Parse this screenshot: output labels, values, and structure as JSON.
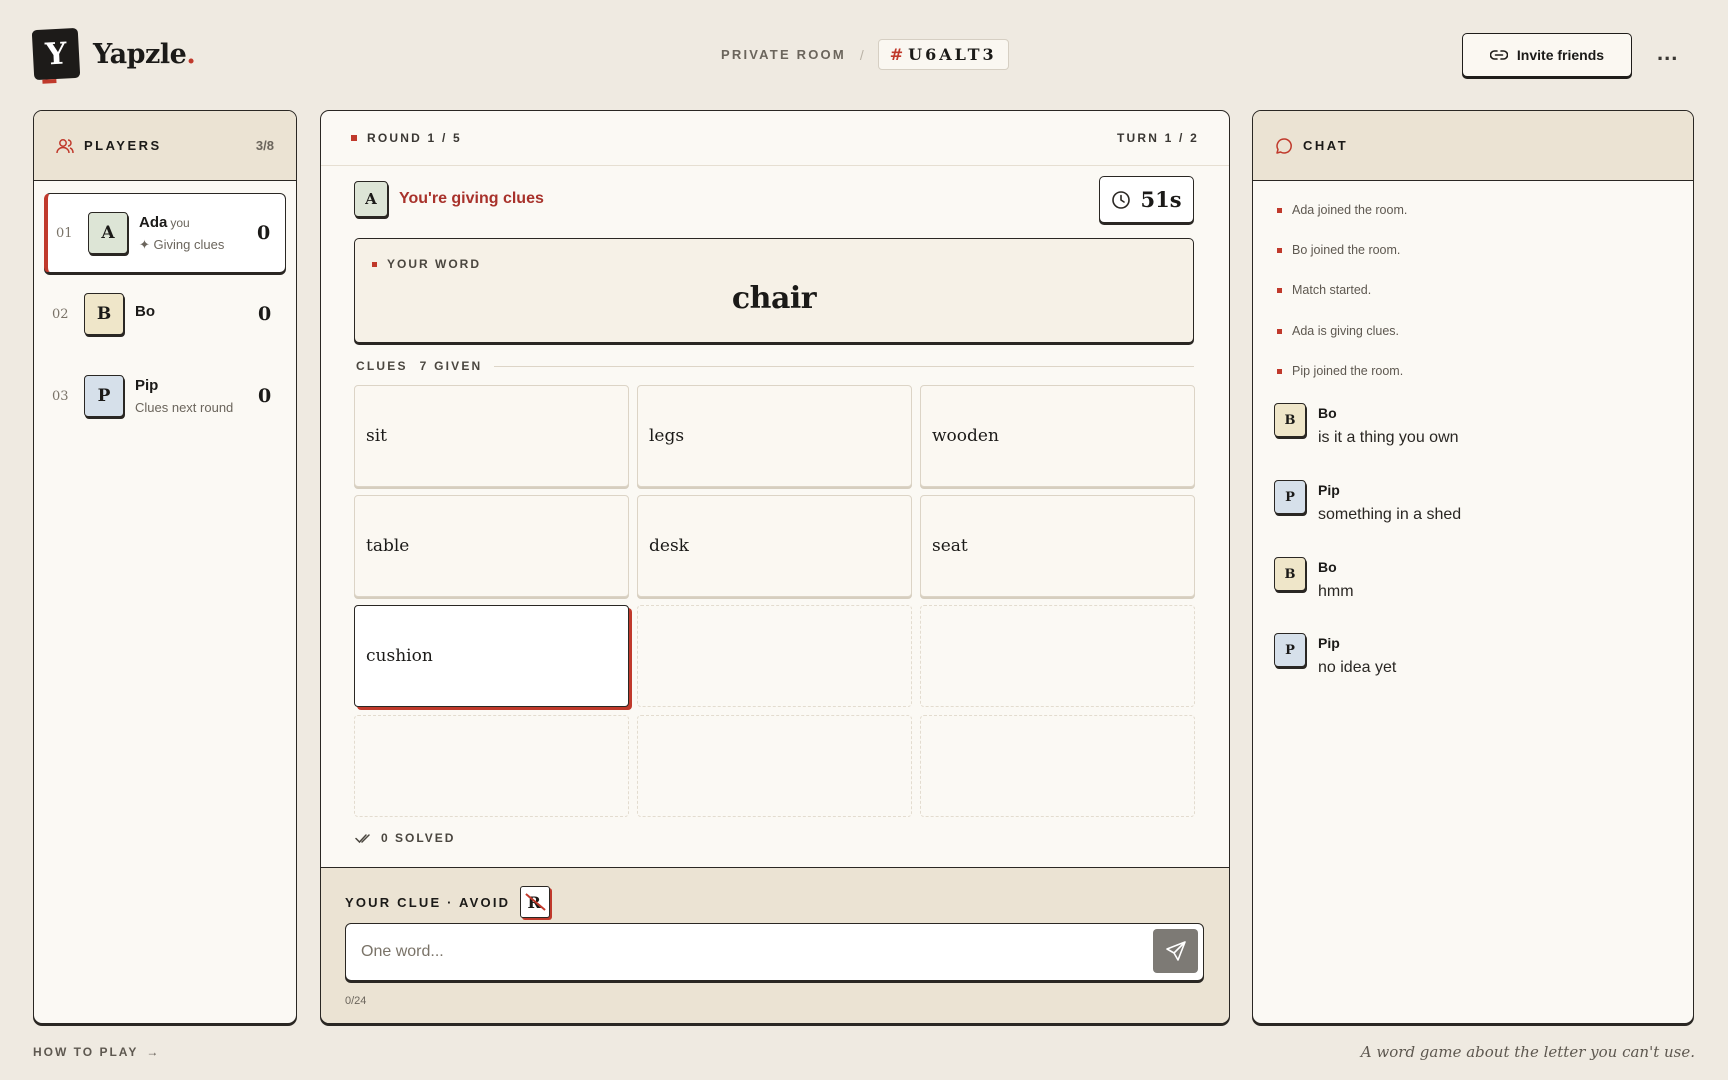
{
  "brand": {
    "name": "Yapzle",
    "dot": ".",
    "mark": "Y"
  },
  "room": {
    "label": "PRIVATE ROOM",
    "separator": "/",
    "hash": "#",
    "code": "U6ALT3"
  },
  "header": {
    "invite_label": "Invite friends",
    "more_label": "..."
  },
  "players": {
    "title": "PLAYERS",
    "count": "3/8",
    "items": [
      {
        "num": "01",
        "initial": "A",
        "name": "Ada",
        "you": "you",
        "status": "✦ Giving clues",
        "score": "0",
        "color": "#dde5d6"
      },
      {
        "num": "02",
        "initial": "B",
        "name": "Bo",
        "status": "",
        "score": "0",
        "color": "#efe6c9"
      },
      {
        "num": "03",
        "initial": "P",
        "name": "Pip",
        "status": "Clues next round",
        "score": "0",
        "color": "#d6e0ea"
      }
    ]
  },
  "game": {
    "round": "ROUND 1 / 5",
    "turn": "TURN 1 / 2",
    "giver_initial": "A",
    "giver_text": "You're giving clues",
    "timer": "51s",
    "word_label": "YOUR WORD",
    "word": "chair",
    "clues_label": "CLUES",
    "clues_given": "7 GIVEN",
    "clues": [
      "sit",
      "legs",
      "wooden",
      "table",
      "desk",
      "seat",
      "cushion"
    ],
    "solved": "0 SOLVED",
    "clue_input_label": "YOUR CLUE · AVOID",
    "avoid_letter": "R",
    "clue_placeholder": "One word...",
    "char_counter": "0/24"
  },
  "chat": {
    "title": "CHAT",
    "system": [
      "Ada joined the room.",
      "Bo joined the room.",
      "Match started.",
      "Ada is giving clues.",
      "Pip joined the room."
    ],
    "messages": [
      {
        "initial": "B",
        "name": "Bo",
        "text": "is it a thing you own",
        "color": "#efe6c9"
      },
      {
        "initial": "P",
        "name": "Pip",
        "text": "something in a shed",
        "color": "#d6e0ea"
      },
      {
        "initial": "B",
        "name": "Bo",
        "text": "hmm",
        "color": "#efe6c9"
      },
      {
        "initial": "P",
        "name": "Pip",
        "text": "no idea yet",
        "color": "#d6e0ea"
      }
    ]
  },
  "footer": {
    "how_to_play": "HOW TO PLAY",
    "arrow": "→",
    "tagline": "A word game about the letter you can't use."
  },
  "colors": {
    "accent": "#c0392b",
    "panel_head": "#ebe3d3",
    "background": "#efeae1"
  }
}
